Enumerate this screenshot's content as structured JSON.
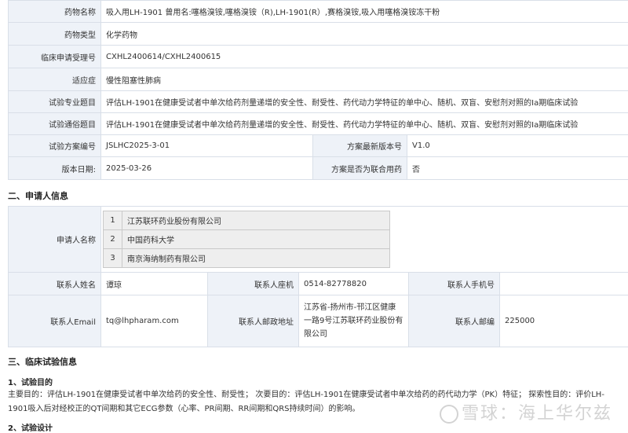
{
  "drug_table": {
    "rows": [
      {
        "label": "药物名称",
        "value": "吸入用LH-1901   曾用名:噻格溴铵,噻格溴铵（R),LH-1901(R）,赛格溴铵,吸入用噻格溴铵冻干粉"
      },
      {
        "label": "药物类型",
        "value": "化学药物"
      },
      {
        "label": "临床申请受理号",
        "value": "CXHL2400614/CXHL2400615"
      },
      {
        "label": "适应症",
        "value": "慢性阻塞性肺病"
      },
      {
        "label": "试验专业题目",
        "value": "评估LH-1901在健康受试者中单次给药剂量递增的安全性、耐受性、药代动力学特征的单中心、随机、双盲、安慰剂对照的Ia期临床试验"
      },
      {
        "label": "试验通俗题目",
        "value": "评估LH-1901在健康受试者中单次给药剂量递增的安全性、耐受性、药代动力学特征的单中心、随机、双盲、安慰剂对照的Ia期临床试验"
      }
    ],
    "protocol_no_label": "试验方案编号",
    "protocol_no": "JSLHC2025-3-01",
    "latest_version_label": "方案最新版本号",
    "latest_version": "V1.0",
    "version_date_label": "版本日期:",
    "version_date": "2025-03-26",
    "combo_label": "方案是否为联合用药",
    "combo_value": "否"
  },
  "section2_title": "二、申请人信息",
  "applicant": {
    "label": "申请人名称",
    "list": [
      {
        "idx": "1",
        "name": "江苏联环药业股份有限公司"
      },
      {
        "idx": "2",
        "name": "中国药科大学"
      },
      {
        "idx": "3",
        "name": "南京海纳制药有限公司"
      }
    ],
    "contact_name_label": "联系人姓名",
    "contact_name": "谭琼",
    "phone_label": "联系人座机",
    "phone": "0514-82778820",
    "mobile_label": "联系人手机号",
    "mobile": "",
    "email_label": "联系人Email",
    "email": "tq@lhpharam.com",
    "address_label": "联系人邮政地址",
    "address": "江苏省-扬州市-邗江区健康一路9号江苏联环药业股份有限公司",
    "zip_label": "联系人邮编",
    "zip": "225000"
  },
  "section3_title": "三、临床试验信息",
  "purpose": {
    "title": "1、试验目的",
    "text": "主要目的：评估LH-1901在健康受试者中单次给药的安全性、耐受性；  次要目的：评估LH-1901在健康受试者中单次给药的药代动力学（PK）特征；  探索性目的：评价LH-1901吸入后对经校正的QT间期和其它ECG参数（心率、PR间期、RR间期和QRS持续时间）的影响。"
  },
  "design_title": "2、试验设计",
  "watermark": "雪球：海上华尔兹"
}
